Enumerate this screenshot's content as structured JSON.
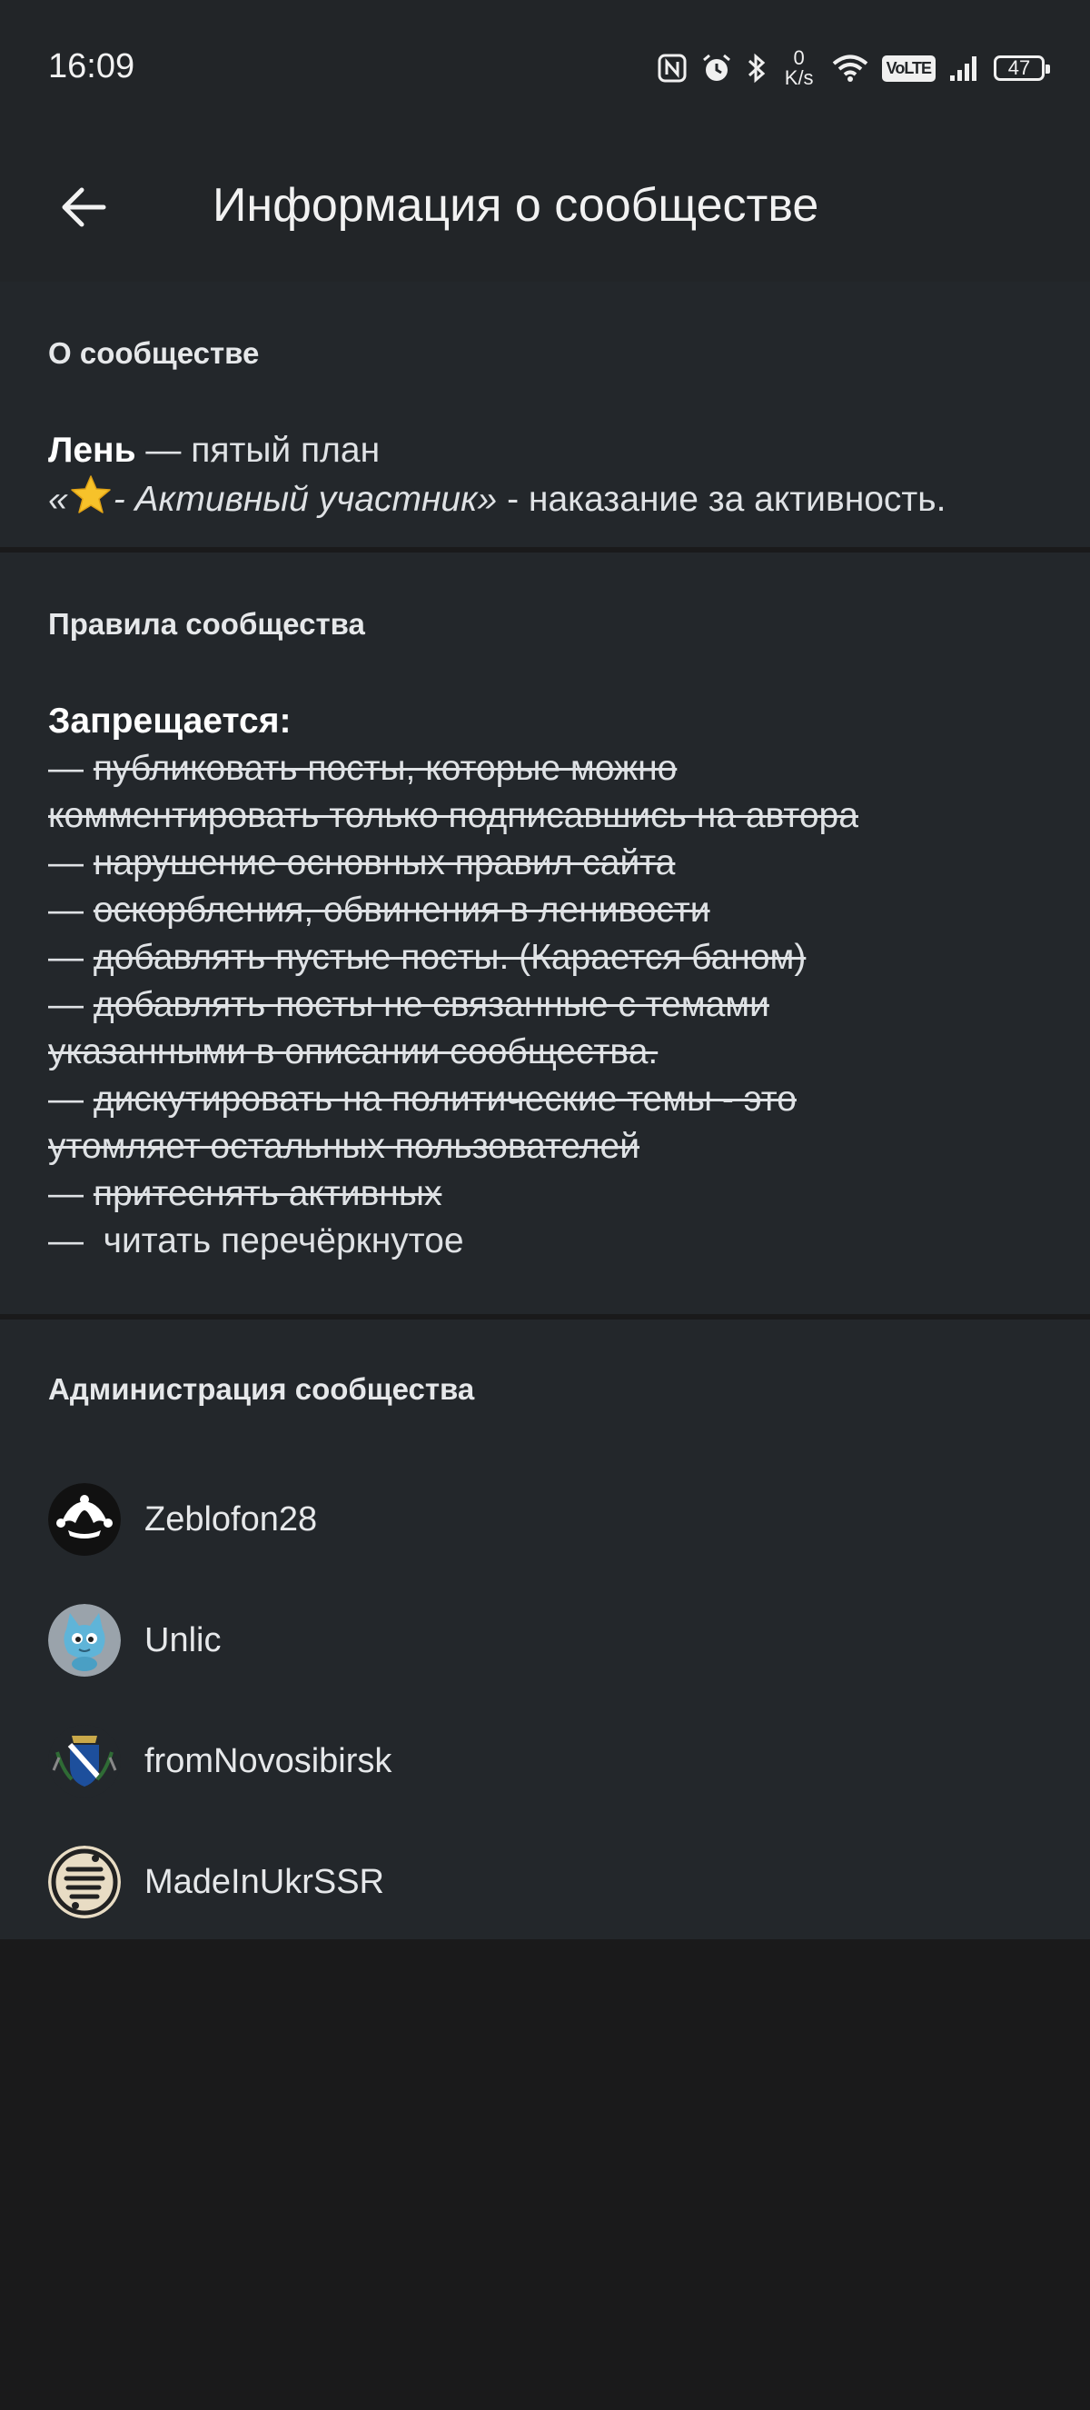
{
  "status_bar": {
    "time": "16:09",
    "net_speed_value": "0",
    "net_speed_unit": "K/s",
    "volte": "VoLTE",
    "battery": "47",
    "icons": [
      "nfc-icon",
      "alarm-icon",
      "bluetooth-icon",
      "wifi-icon",
      "volte-icon",
      "signal-icon",
      "battery-icon"
    ]
  },
  "app_bar": {
    "back_icon": "arrow-left-icon",
    "title": "Информация о сообществе"
  },
  "about": {
    "heading": "О сообществе",
    "line1_bold": "Лень",
    "line1_rest": " — пятый план",
    "line2_open": "«",
    "line2_star": "star-emoji",
    "line2_italic": "- Активный участник",
    "line2_close": "»",
    "line2_rest": " - наказание за активность."
  },
  "rules": {
    "heading": "Правила сообщества",
    "title": "Запрещается:",
    "lines": [
      {
        "dash": "— ",
        "text": "публиковать посты, которые можно"
      },
      {
        "dash": "",
        "text": "комментировать только подписавшись на автора"
      },
      {
        "dash": "— ",
        "text": "нарушение основных правил сайта"
      },
      {
        "dash": "— ",
        "text": "оскорбления, обвинения в ленивости"
      },
      {
        "dash": "— ",
        "text": "добавлять пустые посты. (Карается баном)"
      },
      {
        "dash": "— ",
        "text": "добавлять посты не связанные с темами"
      },
      {
        "dash": "",
        "text": "указанными в описании сообщества."
      },
      {
        "dash": "— ",
        "text": "дискутировать на политические темы - это"
      },
      {
        "dash": "",
        "text": "утомляет остальных пользователей"
      },
      {
        "dash": "— ",
        "text": "притеснять активных"
      }
    ],
    "last_line": "—  читать перечёркнутое"
  },
  "admins": {
    "heading": "Администрация сообщества",
    "users": [
      {
        "name": "Zeblofon28",
        "avatar": "jester-hat-avatar"
      },
      {
        "name": "Unlic",
        "avatar": "blue-cat-avatar"
      },
      {
        "name": "fromNovosibirsk",
        "avatar": "coat-of-arms-avatar"
      },
      {
        "name": "MadeInUkrSSR",
        "avatar": "lettering-avatar"
      }
    ]
  },
  "colors": {
    "background": "#1a1a1b",
    "card": "#23272b",
    "bar": "#222528",
    "text": "#e6e8ea"
  }
}
